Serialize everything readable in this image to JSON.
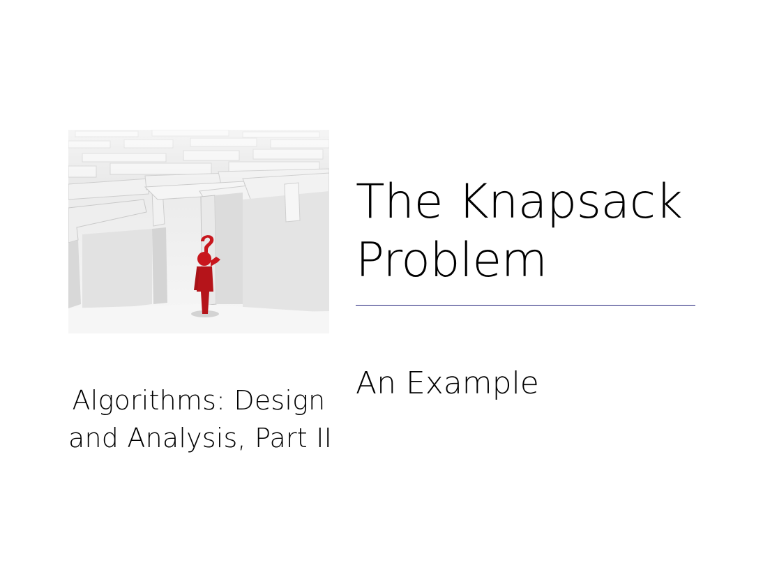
{
  "slide": {
    "title_lines": [
      "The Knapsack",
      "Problem"
    ],
    "subtitle": "An Example",
    "course_lines": [
      "Algorithms: Design",
      "and Analysis, Part II"
    ]
  },
  "image": {
    "subject": "maze-with-red-figure-and-question-mark",
    "colors": {
      "wall": "#f2f2f2",
      "wall_shadow": "#cfcfcf",
      "floor": "#e4e4e4",
      "figure": "#c8161d"
    }
  },
  "colors": {
    "rule": "#1e1e78",
    "text": "#000000"
  }
}
